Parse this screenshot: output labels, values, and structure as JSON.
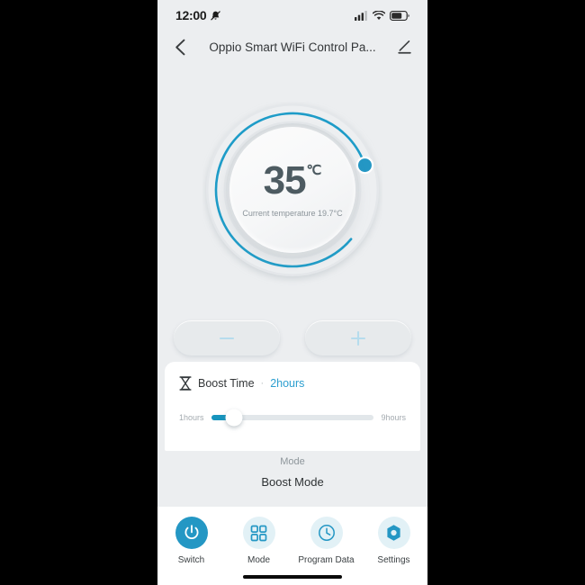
{
  "status_bar": {
    "time": "12:00",
    "mute_icon": "bell-slash-icon",
    "signal_icon": "cellular-signal-icon",
    "wifi_icon": "wifi-icon",
    "battery_icon": "battery-icon"
  },
  "header": {
    "back_icon": "chevron-left-icon",
    "title": "Oppio Smart WiFi Control Pa...",
    "edit_icon": "pencil-edit-icon"
  },
  "dial": {
    "target_temperature": "35",
    "unit": "℃",
    "current_temperature_text": "Current temperature 19.7°C",
    "arc_color": "#1e9cc8",
    "track_color": "#e2e6e9",
    "knob_color": "#2497c4",
    "arc_percent": 92
  },
  "adjust": {
    "minus_label": "−",
    "minus_icon": "minus-icon",
    "plus_label": "+",
    "plus_icon": "plus-icon",
    "icon_color": "#b6dced"
  },
  "boost": {
    "icon": "hourglass-icon",
    "label": "Boost Time",
    "separator": "·",
    "value": "2hours",
    "value_color": "#2d9fd0",
    "slider": {
      "min_label": "1hours",
      "max_label": "9hours",
      "min": 1,
      "max": 9,
      "value": 2,
      "fill_percent": 14,
      "fill_color": "#1694bd",
      "track_color": "#e2e7ea"
    }
  },
  "mode": {
    "label": "Mode",
    "value": "Boost Mode"
  },
  "bottom_nav": {
    "items": [
      {
        "label": "Switch",
        "icon": "power-icon",
        "active": true
      },
      {
        "label": "Mode",
        "icon": "grid-squares-icon",
        "active": false
      },
      {
        "label": "Program Data",
        "icon": "clock-icon",
        "active": false
      },
      {
        "label": "Settings",
        "icon": "hex-gear-icon",
        "active": false
      }
    ],
    "active_color": "#2497c4",
    "inactive_bg": "#e2f1f6",
    "icon_color": "#2497c4"
  }
}
